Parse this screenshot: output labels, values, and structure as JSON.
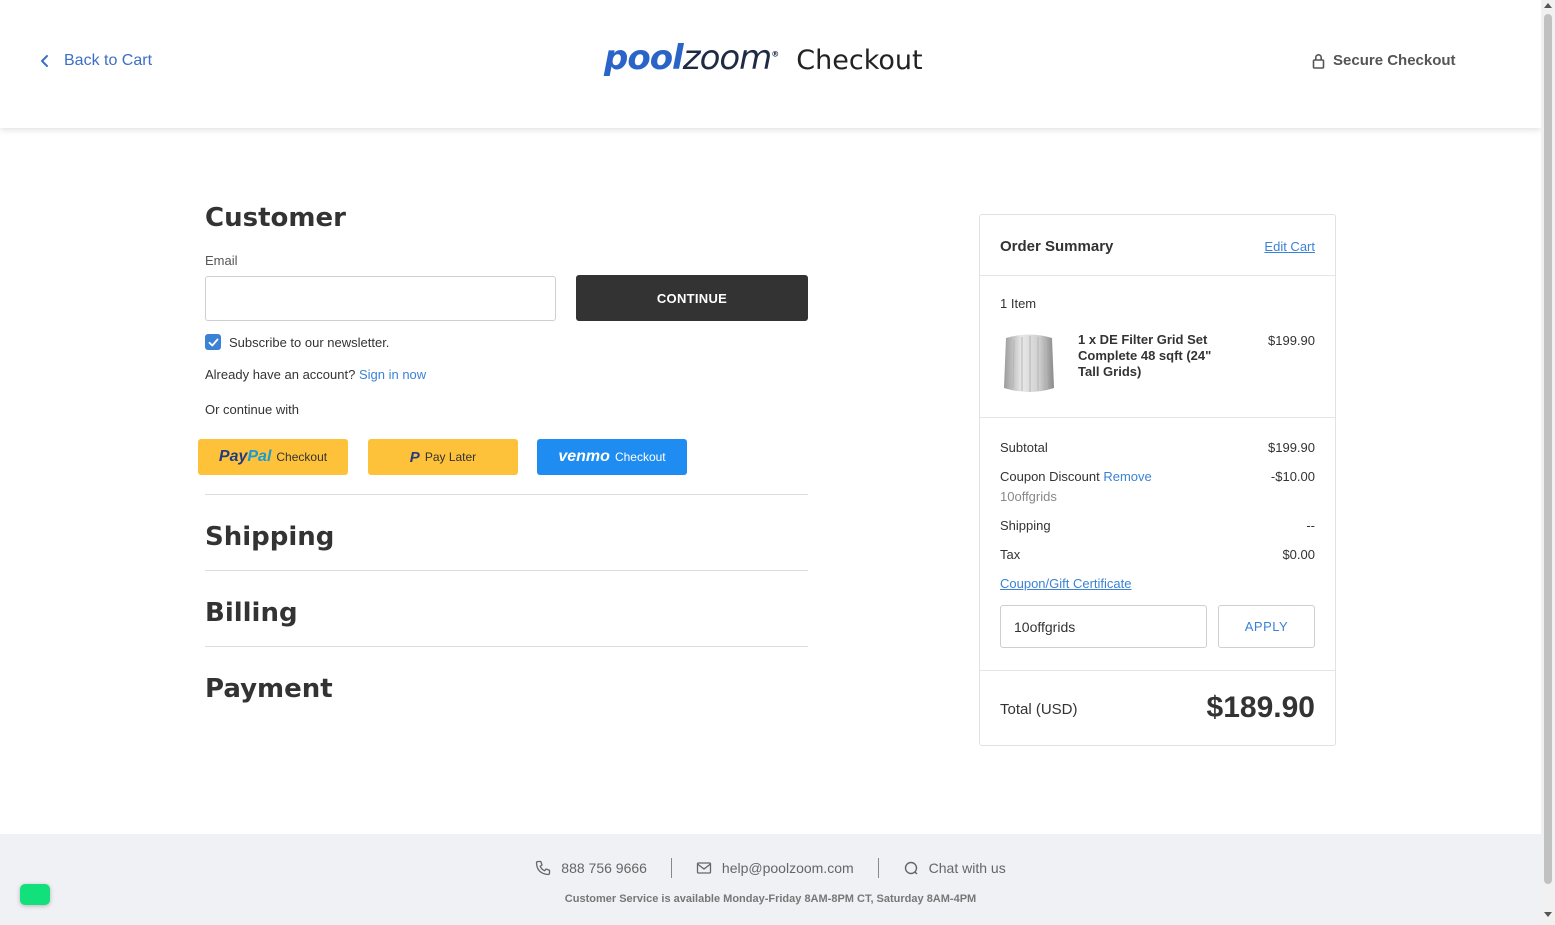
{
  "header": {
    "back_label": "Back to Cart",
    "logo": {
      "pool": "pool",
      "zoom": "zoom",
      "mark": "®"
    },
    "title": "Checkout",
    "secure_label": "Secure Checkout"
  },
  "customer": {
    "heading": "Customer",
    "email_label": "Email",
    "email_value": "",
    "continue_label": "CONTINUE",
    "newsletter_label": "Subscribe to our newsletter.",
    "newsletter_checked": true,
    "account_prompt": "Already have an account?",
    "sign_in_label": "Sign in now",
    "or_continue": "Or continue with",
    "paypal": {
      "pay": "Pay",
      "pal": "Pal",
      "label": "Checkout"
    },
    "paylater": {
      "icon": "P",
      "label": "Pay Later"
    },
    "venmo": {
      "logo": "venmo",
      "label": "Checkout"
    }
  },
  "sections": {
    "shipping": "Shipping",
    "billing": "Billing",
    "payment": "Payment"
  },
  "summary": {
    "title": "Order Summary",
    "edit_cart": "Edit Cart",
    "items_count": "1 Item",
    "item": {
      "name": "1 x DE Filter Grid Set Complete 48 sqft (24\" Tall Grids)",
      "price": "$199.90"
    },
    "subtotal_label": "Subtotal",
    "subtotal_value": "$199.90",
    "coupon_label": "Coupon Discount",
    "coupon_remove": "Remove",
    "coupon_value": "-$10.00",
    "coupon_code": "10offgrids",
    "shipping_label": "Shipping",
    "shipping_value": "--",
    "tax_label": "Tax",
    "tax_value": "$0.00",
    "gift_link": "Coupon/Gift Certificate",
    "coupon_input_value": "10offgrids",
    "apply_label": "APPLY",
    "total_label": "Total (USD)",
    "total_value": "$189.90"
  },
  "footer": {
    "phone": "888 756 9666",
    "email": "help@poolzoom.com",
    "chat": "Chat with us",
    "hours": "Customer Service is available Monday-Friday 8AM-8PM CT, Saturday 8AM-4PM"
  },
  "colors": {
    "accent": "#3b82d6",
    "brand_blue": "#2a64c8",
    "paypal_yellow": "#fec23a",
    "venmo_blue": "#1e8cf0",
    "dark_button": "#333333",
    "chat_green": "#12e07a"
  }
}
